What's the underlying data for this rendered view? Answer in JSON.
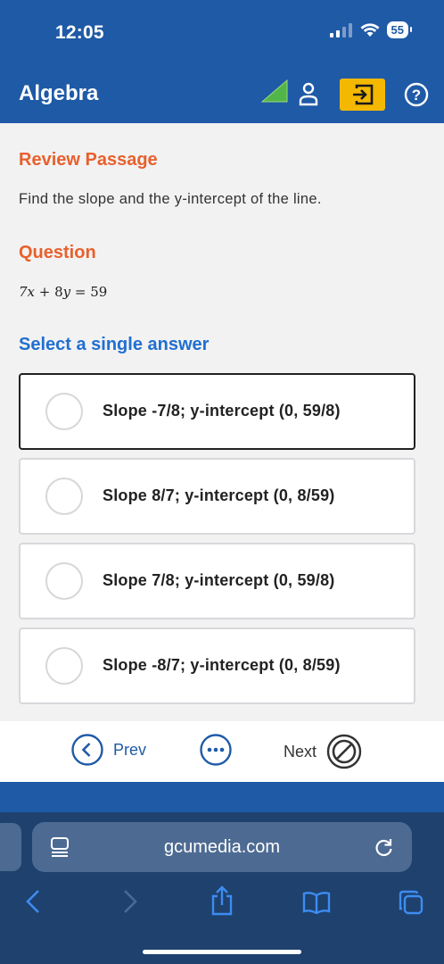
{
  "status_bar": {
    "time": "12:05",
    "battery": "55"
  },
  "header": {
    "title": "Algebra",
    "icons": [
      "signal-triangle-icon",
      "user-icon",
      "exit-icon",
      "help-icon"
    ]
  },
  "passage": {
    "heading": "Review Passage",
    "text": "Find the slope and the y-intercept of the line."
  },
  "question": {
    "heading": "Question",
    "equation": "7x + 8y = 59"
  },
  "answers": {
    "prompt": "Select a single answer",
    "options": [
      {
        "label": "Slope -7/8; y-intercept (0, 59/8)",
        "focused": true
      },
      {
        "label": "Slope 8/7; y-intercept (0, 8/59)",
        "focused": false
      },
      {
        "label": "Slope 7/8; y-intercept (0, 59/8)",
        "focused": false
      },
      {
        "label": "Slope -8/7; y-intercept (0, 8/59)",
        "focused": false
      }
    ]
  },
  "navigation": {
    "prev_label": "Prev",
    "next_label": "Next"
  },
  "browser": {
    "url": "gcumedia.com"
  },
  "colors": {
    "header_blue": "#1f5aa6",
    "accent_orange": "#e8602c",
    "link_blue": "#1f6fd1",
    "exit_yellow": "#f5b800",
    "triangle_green": "#52b54a"
  }
}
